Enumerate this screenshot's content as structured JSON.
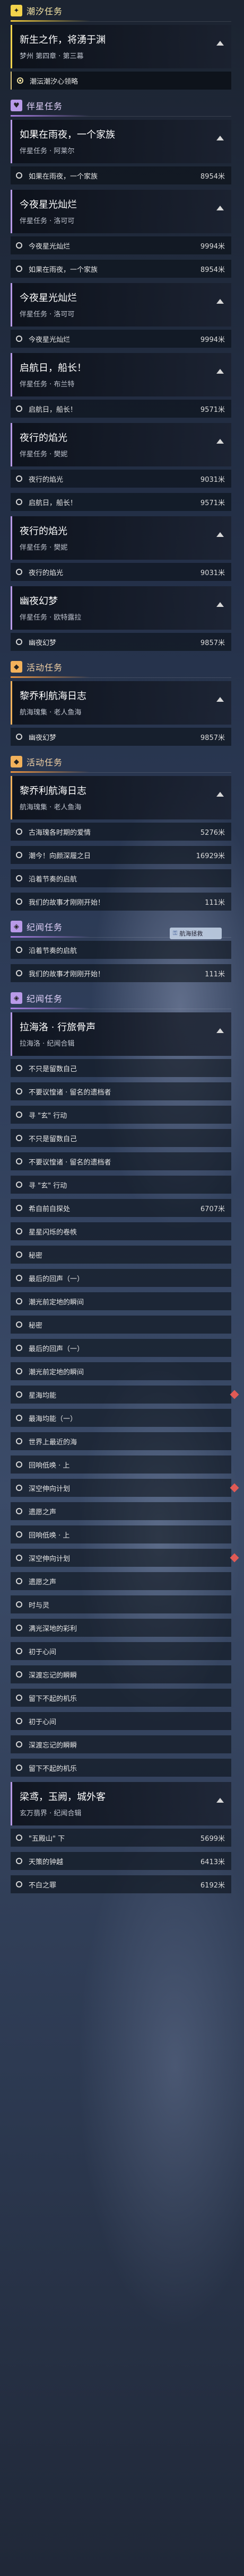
{
  "popup": {
    "icon": "lock-icon",
    "label": "航海拯救"
  },
  "rows": [
    {
      "kind": "header",
      "color": "yellow",
      "icon": "story-icon",
      "icon_char": "✦",
      "text": "潮汐任务"
    },
    {
      "kind": "quest",
      "color": "yellow",
      "title": "新生之作，将湧于渊",
      "sub": "梦州 第四章 · 第三幕"
    },
    {
      "kind": "step",
      "active": true,
      "text": "潮沄潮汐心领略",
      "dist": ""
    },
    {
      "kind": "header",
      "color": "purple",
      "icon": "companion-icon",
      "icon_char": "♥",
      "text": "伴星任务"
    },
    {
      "kind": "quest",
      "color": "purple",
      "title": "如果在雨夜，一个家族",
      "sub": "伴星任务 · 阿莱尔"
    },
    {
      "kind": "step",
      "text": "如果在雨夜，一个家族",
      "dist": "8954米"
    },
    {
      "kind": "quest",
      "color": "purple",
      "title": "今夜星光灿烂",
      "sub": "伴星任务 · 洛可可"
    },
    {
      "kind": "step",
      "text": "今夜星光灿烂",
      "dist": "9994米"
    },
    {
      "kind": "step",
      "text": "如果在雨夜，一个家族",
      "dist": "8954米"
    },
    {
      "kind": "quest",
      "color": "purple",
      "title": "今夜星光灿烂",
      "sub": "伴星任务 · 洛可可"
    },
    {
      "kind": "step",
      "text": "今夜星光灿烂",
      "dist": "9994米"
    },
    {
      "kind": "quest",
      "color": "purple",
      "title": "启航日，船长！",
      "sub": "伴星任务 · 布兰特"
    },
    {
      "kind": "step",
      "text": "启航日，船长！",
      "dist": "9571米"
    },
    {
      "kind": "quest",
      "color": "purple",
      "title": "夜行的焰光",
      "sub": "伴星任务 · 樊妮"
    },
    {
      "kind": "step",
      "text": "夜行的焰光",
      "dist": "9031米"
    },
    {
      "kind": "step",
      "text": "启航日，船长！",
      "dist": "9571米"
    },
    {
      "kind": "quest",
      "color": "purple",
      "title": "夜行的焰光",
      "sub": "伴星任务 · 樊妮"
    },
    {
      "kind": "step",
      "text": "夜行的焰光",
      "dist": "9031米"
    },
    {
      "kind": "quest",
      "color": "purple",
      "title": "幽夜幻梦",
      "sub": "伴星任务 · 欧特露拉"
    },
    {
      "kind": "step",
      "text": "幽夜幻梦",
      "dist": "9857米"
    },
    {
      "kind": "header",
      "color": "orange",
      "icon": "event-icon",
      "icon_char": "◆",
      "text": "活动任务"
    },
    {
      "kind": "quest",
      "color": "orange",
      "title": "黎乔利航海日志",
      "sub": "航海瑰集 · 老人鱼海"
    },
    {
      "kind": "step",
      "text": "幽夜幻梦",
      "dist": "9857米"
    },
    {
      "kind": "header",
      "color": "orange",
      "icon": "event-icon",
      "icon_char": "◆",
      "text": "活动任务"
    },
    {
      "kind": "quest",
      "color": "orange",
      "title": "黎乔利航海日志",
      "sub": "航海瑰集 · 老人鱼海"
    },
    {
      "kind": "step",
      "text": "古海瑰各时期的爱情",
      "dist": "5276米"
    },
    {
      "kind": "step",
      "text": "潮今！向颜深履之日",
      "dist": "16929米"
    },
    {
      "kind": "step",
      "text": "沿着节奏的启航",
      "dist": ""
    },
    {
      "kind": "step",
      "text": "我们的故事才刚刚开始！",
      "dist": "111米"
    },
    {
      "kind": "header",
      "color": "purple",
      "icon": "memory-icon",
      "icon_char": "◈",
      "text": "纪闻任务"
    },
    {
      "kind": "step",
      "text": "沿着节奏的启航",
      "dist": ""
    },
    {
      "kind": "step",
      "text": "我们的故事才刚刚开始！",
      "dist": "111米"
    },
    {
      "kind": "header",
      "color": "purple",
      "icon": "memory-icon",
      "icon_char": "◈",
      "text": "纪闻任务"
    },
    {
      "kind": "quest",
      "color": "purple",
      "title": "拉海洛 · 行旅骨声",
      "sub": "拉海洛 · 纪闻合辑"
    },
    {
      "kind": "step",
      "text": "不只是留数自己",
      "dist": ""
    },
    {
      "kind": "step",
      "text": "不要议惶诸 · 留名的遗档者",
      "dist": ""
    },
    {
      "kind": "step",
      "text": "寻 \"玄\" 行动",
      "dist": ""
    },
    {
      "kind": "step",
      "text": "不只是留数自己",
      "dist": ""
    },
    {
      "kind": "step",
      "text": "不要议惶诸 · 留名的遗档者",
      "dist": ""
    },
    {
      "kind": "step",
      "text": "寻 \"玄\" 行动",
      "dist": ""
    },
    {
      "kind": "step",
      "text": "希自前自探处",
      "dist": "6707米"
    },
    {
      "kind": "step",
      "text": "星星闪烁的卷帙",
      "dist": ""
    },
    {
      "kind": "step",
      "text": "秘密",
      "dist": ""
    },
    {
      "kind": "step",
      "text": "最后的回声（一）",
      "dist": ""
    },
    {
      "kind": "step",
      "text": "潮光前定地的瞬间",
      "dist": ""
    },
    {
      "kind": "step",
      "text": "秘密",
      "dist": ""
    },
    {
      "kind": "step",
      "text": "最后的回声（一）",
      "dist": ""
    },
    {
      "kind": "step",
      "text": "潮光前定地的瞬间",
      "dist": ""
    },
    {
      "kind": "step",
      "text": "星海均能",
      "dist": "",
      "marker": true
    },
    {
      "kind": "step",
      "text": "最海均能（一）",
      "dist": ""
    },
    {
      "kind": "step",
      "text": "世界上最近的海",
      "dist": ""
    },
    {
      "kind": "step",
      "text": "回响低唤 · 上",
      "dist": ""
    },
    {
      "kind": "step",
      "text": "深空伸向计划",
      "dist": "",
      "marker": true
    },
    {
      "kind": "step",
      "text": "遗愿之声",
      "dist": ""
    },
    {
      "kind": "step",
      "text": "回响低唤 · 上",
      "dist": ""
    },
    {
      "kind": "step",
      "text": "深空伸向计划",
      "dist": "",
      "marker": true
    },
    {
      "kind": "step",
      "text": "遗愿之声",
      "dist": ""
    },
    {
      "kind": "step",
      "text": "时与灵",
      "dist": ""
    },
    {
      "kind": "step",
      "text": "满光深地的彩利",
      "dist": ""
    },
    {
      "kind": "step",
      "text": "初于心间",
      "dist": ""
    },
    {
      "kind": "step",
      "text": "深渡忘记的瞬瞬",
      "dist": ""
    },
    {
      "kind": "step",
      "text": "留下不起的机乐",
      "dist": ""
    },
    {
      "kind": "step",
      "text": "初于心间",
      "dist": ""
    },
    {
      "kind": "step",
      "text": "深渡忘记的瞬瞬",
      "dist": ""
    },
    {
      "kind": "step",
      "text": "留下不起的机乐",
      "dist": ""
    },
    {
      "kind": "quest",
      "color": "purple",
      "title": "梁鸢，玉阙，城外客",
      "sub": "玄万翡界 · 纪闻合辑"
    },
    {
      "kind": "step",
      "text": "\"五殿山\" 下",
      "dist": "5699米"
    },
    {
      "kind": "step",
      "text": "天策的钟越",
      "dist": "6413米"
    },
    {
      "kind": "step",
      "text": "不白之罪",
      "dist": "6192米"
    }
  ]
}
